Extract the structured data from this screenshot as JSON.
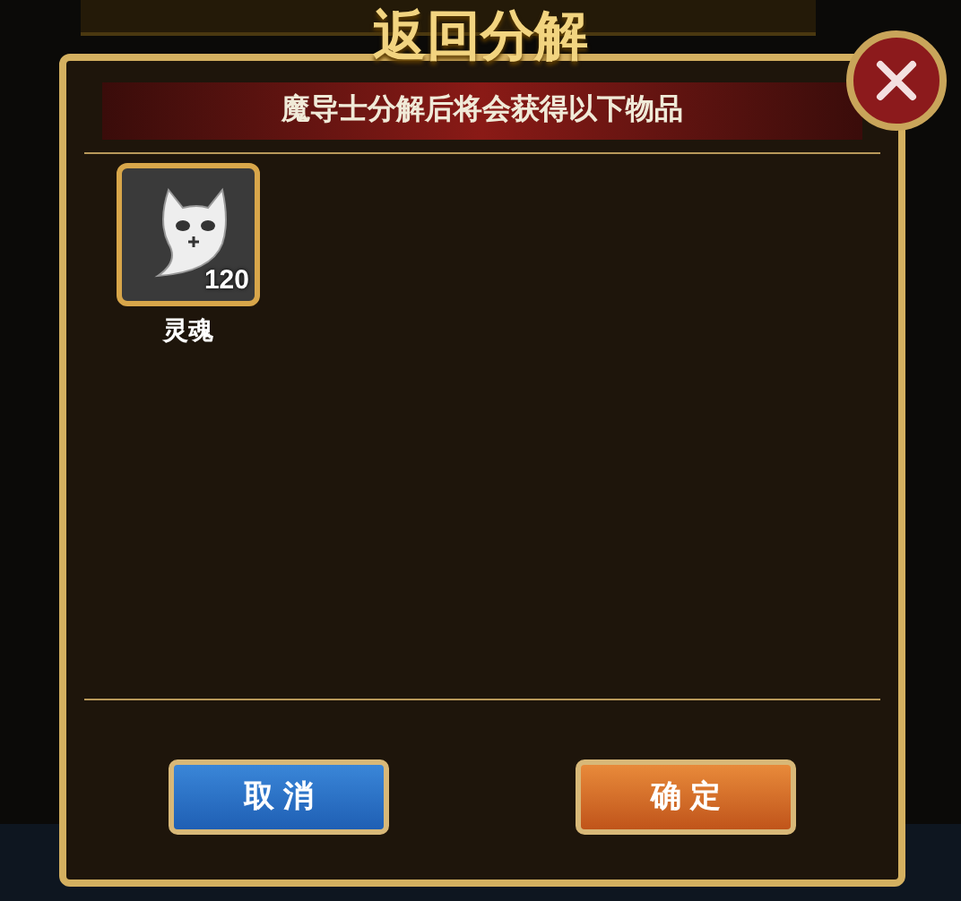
{
  "dialog": {
    "title": "返回分解",
    "subtitle": "魔导士分解后将会获得以下物品"
  },
  "items": [
    {
      "name": "灵魂",
      "count": "120"
    }
  ],
  "buttons": [
    {
      "label": "取 消",
      "kind": "cancel"
    },
    {
      "label": "确 定",
      "kind": "confirm"
    }
  ]
}
